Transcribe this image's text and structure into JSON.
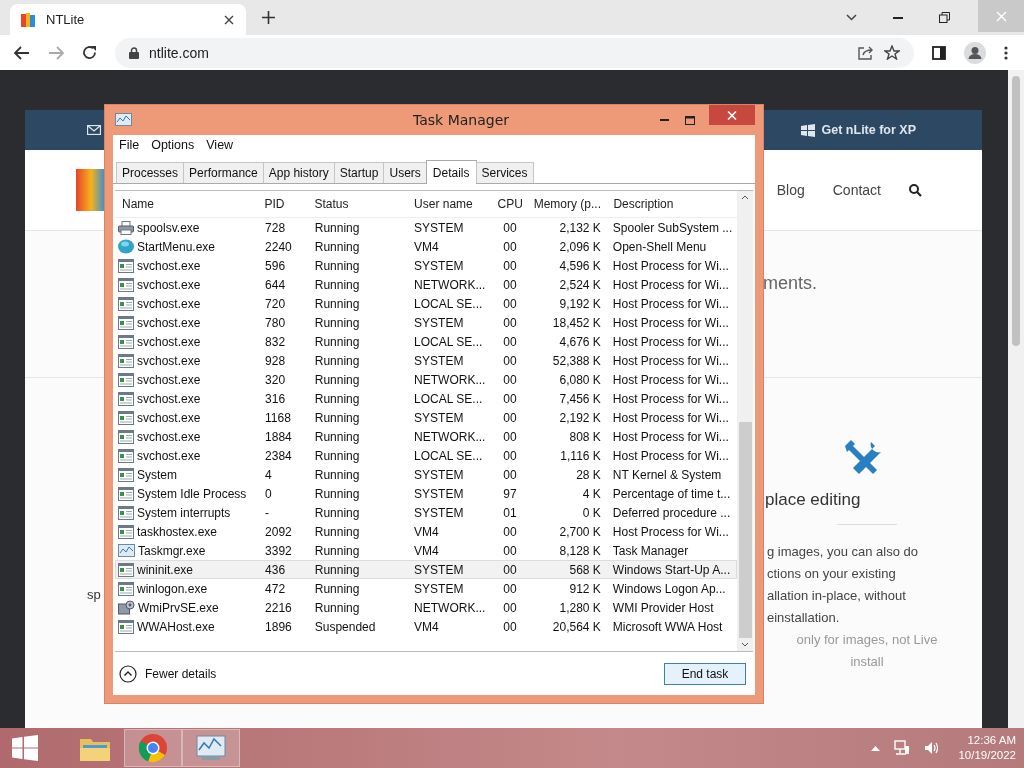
{
  "browser": {
    "tab_title": "NTLite",
    "url": "ntlite.com"
  },
  "website": {
    "header_link": "Get nLite for XP",
    "nav": [
      "Blog",
      "Contact"
    ],
    "fragment_top": "ments.",
    "feature_title": "place editing",
    "feature_text": [
      "g images, you can also do",
      "ctions on your existing",
      "allation in-place, without",
      "einstallation."
    ],
    "feature_note": [
      "only for images, not Live",
      "install"
    ],
    "left_fragment": "sp"
  },
  "task_manager": {
    "title": "Task Manager",
    "menu": [
      "File",
      "Options",
      "View"
    ],
    "tabs": [
      {
        "label": "Processes",
        "selected": false
      },
      {
        "label": "Performance",
        "selected": false
      },
      {
        "label": "App history",
        "selected": false
      },
      {
        "label": "Startup",
        "selected": false
      },
      {
        "label": "Users",
        "selected": false
      },
      {
        "label": "Details",
        "selected": true
      },
      {
        "label": "Services",
        "selected": false
      }
    ],
    "columns": [
      "Name",
      "PID",
      "Status",
      "User name",
      "CPU",
      "Memory (p...",
      "Description"
    ],
    "rows": [
      {
        "kind": "printer",
        "name": "spoolsv.exe",
        "pid": "728",
        "status": "Running",
        "user": "SYSTEM",
        "cpu": "00",
        "memory": "2,132 K",
        "description": "Spooler SubSystem ...",
        "selected": false
      },
      {
        "kind": "globe",
        "name": "StartMenu.exe",
        "pid": "2240",
        "status": "Running",
        "user": "VM4",
        "cpu": "00",
        "memory": "2,096 K",
        "description": "Open-Shell Menu",
        "selected": false
      },
      {
        "kind": "window",
        "name": "svchost.exe",
        "pid": "596",
        "status": "Running",
        "user": "SYSTEM",
        "cpu": "00",
        "memory": "4,596 K",
        "description": "Host Process for Wi...",
        "selected": false
      },
      {
        "kind": "window",
        "name": "svchost.exe",
        "pid": "644",
        "status": "Running",
        "user": "NETWORK...",
        "cpu": "00",
        "memory": "2,524 K",
        "description": "Host Process for Wi...",
        "selected": false
      },
      {
        "kind": "window",
        "name": "svchost.exe",
        "pid": "720",
        "status": "Running",
        "user": "LOCAL SE...",
        "cpu": "00",
        "memory": "9,192 K",
        "description": "Host Process for Wi...",
        "selected": false
      },
      {
        "kind": "window",
        "name": "svchost.exe",
        "pid": "780",
        "status": "Running",
        "user": "SYSTEM",
        "cpu": "00",
        "memory": "18,452 K",
        "description": "Host Process for Wi...",
        "selected": false
      },
      {
        "kind": "window",
        "name": "svchost.exe",
        "pid": "832",
        "status": "Running",
        "user": "LOCAL SE...",
        "cpu": "00",
        "memory": "4,676 K",
        "description": "Host Process for Wi...",
        "selected": false
      },
      {
        "kind": "window",
        "name": "svchost.exe",
        "pid": "928",
        "status": "Running",
        "user": "SYSTEM",
        "cpu": "00",
        "memory": "52,388 K",
        "description": "Host Process for Wi...",
        "selected": false
      },
      {
        "kind": "window",
        "name": "svchost.exe",
        "pid": "320",
        "status": "Running",
        "user": "NETWORK...",
        "cpu": "00",
        "memory": "6,080 K",
        "description": "Host Process for Wi...",
        "selected": false
      },
      {
        "kind": "window",
        "name": "svchost.exe",
        "pid": "316",
        "status": "Running",
        "user": "LOCAL SE...",
        "cpu": "00",
        "memory": "7,456 K",
        "description": "Host Process for Wi...",
        "selected": false
      },
      {
        "kind": "window",
        "name": "svchost.exe",
        "pid": "1168",
        "status": "Running",
        "user": "SYSTEM",
        "cpu": "00",
        "memory": "2,192 K",
        "description": "Host Process for Wi...",
        "selected": false
      },
      {
        "kind": "window",
        "name": "svchost.exe",
        "pid": "1884",
        "status": "Running",
        "user": "NETWORK...",
        "cpu": "00",
        "memory": "808 K",
        "description": "Host Process for Wi...",
        "selected": false
      },
      {
        "kind": "window",
        "name": "svchost.exe",
        "pid": "2384",
        "status": "Running",
        "user": "LOCAL SE...",
        "cpu": "00",
        "memory": "1,116 K",
        "description": "Host Process for Wi...",
        "selected": false
      },
      {
        "kind": "window",
        "name": "System",
        "pid": "4",
        "status": "Running",
        "user": "SYSTEM",
        "cpu": "00",
        "memory": "28 K",
        "description": "NT Kernel & System",
        "selected": false
      },
      {
        "kind": "window",
        "name": "System Idle Process",
        "pid": "0",
        "status": "Running",
        "user": "SYSTEM",
        "cpu": "97",
        "memory": "4 K",
        "description": "Percentage of time t...",
        "selected": false
      },
      {
        "kind": "window",
        "name": "System interrupts",
        "pid": "-",
        "status": "Running",
        "user": "SYSTEM",
        "cpu": "01",
        "memory": "0 K",
        "description": "Deferred procedure ...",
        "selected": false
      },
      {
        "kind": "window",
        "name": "taskhostex.exe",
        "pid": "2092",
        "status": "Running",
        "user": "VM4",
        "cpu": "00",
        "memory": "2,700 K",
        "description": "Host Process for Wi...",
        "selected": false
      },
      {
        "kind": "chart",
        "name": "Taskmgr.exe",
        "pid": "3392",
        "status": "Running",
        "user": "VM4",
        "cpu": "00",
        "memory": "8,128 K",
        "description": "Task Manager",
        "selected": false
      },
      {
        "kind": "window",
        "name": "wininit.exe",
        "pid": "436",
        "status": "Running",
        "user": "SYSTEM",
        "cpu": "00",
        "memory": "568 K",
        "description": "Windows Start-Up A...",
        "selected": true
      },
      {
        "kind": "window",
        "name": "winlogon.exe",
        "pid": "472",
        "status": "Running",
        "user": "SYSTEM",
        "cpu": "00",
        "memory": "912 K",
        "description": "Windows Logon Ap...",
        "selected": false
      },
      {
        "kind": "gear",
        "name": "WmiPrvSE.exe",
        "pid": "2216",
        "status": "Running",
        "user": "NETWORK...",
        "cpu": "00",
        "memory": "1,280 K",
        "description": "WMI Provider Host",
        "selected": false
      },
      {
        "kind": "window",
        "name": "WWAHost.exe",
        "pid": "1896",
        "status": "Suspended",
        "user": "VM4",
        "cpu": "00",
        "memory": "20,564 K",
        "description": "Microsoft WWA Host",
        "selected": false
      }
    ],
    "fewer_details": "Fewer details",
    "end_task": "End task"
  },
  "taskbar": {
    "apps": [
      {
        "kind": "folder",
        "selected": false
      },
      {
        "kind": "browser",
        "selected": true
      },
      {
        "kind": "monitor",
        "selected": true
      }
    ],
    "time": "12:36 AM",
    "date": "10/19/2022"
  }
}
